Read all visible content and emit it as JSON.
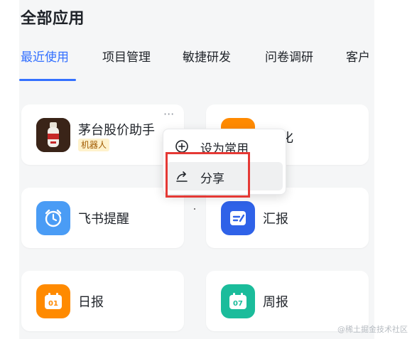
{
  "section_title": "全部应用",
  "tabs": [
    {
      "label": "最近使用",
      "active": true
    },
    {
      "label": "项目管理",
      "active": false
    },
    {
      "label": "敏捷研发",
      "active": false
    },
    {
      "label": "问卷调研",
      "active": false
    },
    {
      "label": "客户",
      "active": false
    }
  ],
  "apps": [
    {
      "name": "茅台股价助手",
      "tag": "机器人",
      "icon": "liquor-bottle-icon",
      "more_label": "···"
    },
    {
      "name": "化",
      "icon": "orange-app-icon"
    },
    {
      "name": "飞书提醒",
      "icon": "alarm-clock-icon"
    },
    {
      "name": "汇报",
      "icon": "report-icon"
    },
    {
      "name": "日报",
      "icon": "daily-report-icon",
      "badge": "01"
    },
    {
      "name": "周报",
      "icon": "weekly-report-icon",
      "badge": "07"
    }
  ],
  "context_menu": {
    "items": [
      {
        "label": "设为常用",
        "icon": "add-circle-icon"
      },
      {
        "label": "分享",
        "icon": "share-icon",
        "hovered": true
      }
    ]
  },
  "watermark": "@稀土掘金技术社区",
  "colors": {
    "accent": "#3370ff",
    "highlight": "#e53935",
    "orange": "#ff8a00",
    "teal": "#1bbc9b"
  }
}
